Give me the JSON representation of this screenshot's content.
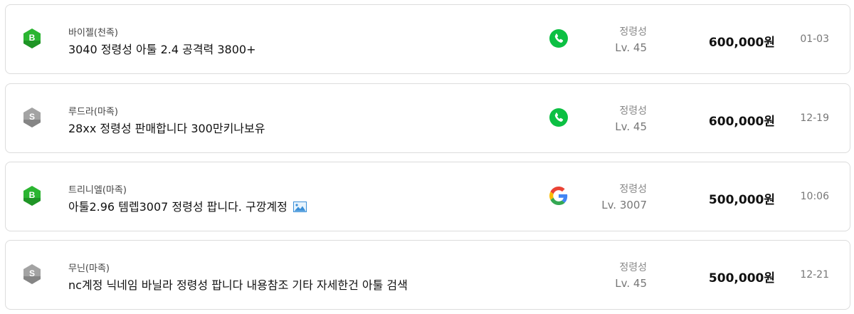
{
  "listings": [
    {
      "badge": "B",
      "badge_type": "bronze-green",
      "server": "바이젤(천족)",
      "title": "3040 정령성 아툴 2.4 공격력 3800+",
      "has_image": false,
      "contact_icon": "phone-icon",
      "job": "정령성",
      "level": "Lv. 45",
      "price": "600,000원",
      "date": "01-03"
    },
    {
      "badge": "S",
      "badge_type": "silver-gray",
      "server": "루드라(마족)",
      "title": "28xx 정령성 판매합니다 300만키나보유",
      "has_image": false,
      "contact_icon": "phone-icon",
      "job": "정령성",
      "level": "Lv. 45",
      "price": "600,000원",
      "date": "12-19"
    },
    {
      "badge": "B",
      "badge_type": "bronze-green",
      "server": "트리니엘(마족)",
      "title": "아툴2.96 템렙3007 정령성 팝니다. 구깡계정",
      "has_image": true,
      "contact_icon": "google-icon",
      "job": "정령성",
      "level": "Lv. 3007",
      "price": "500,000원",
      "date": "10:06"
    },
    {
      "badge": "S",
      "badge_type": "silver-gray",
      "server": "무닌(마족)",
      "title": "nc계정 닉네임 바닐라 정령성 팝니다 내용참조 기타 자세한건 아툴 검색",
      "has_image": false,
      "contact_icon": "none",
      "job": "정령성",
      "level": "Lv. 45",
      "price": "500,000원",
      "date": "12-21"
    }
  ],
  "colors": {
    "badge_green": "#2bb531",
    "badge_gray": "#9a9a9a",
    "phone_green": "#0cc043",
    "border": "#dcdcdc"
  }
}
